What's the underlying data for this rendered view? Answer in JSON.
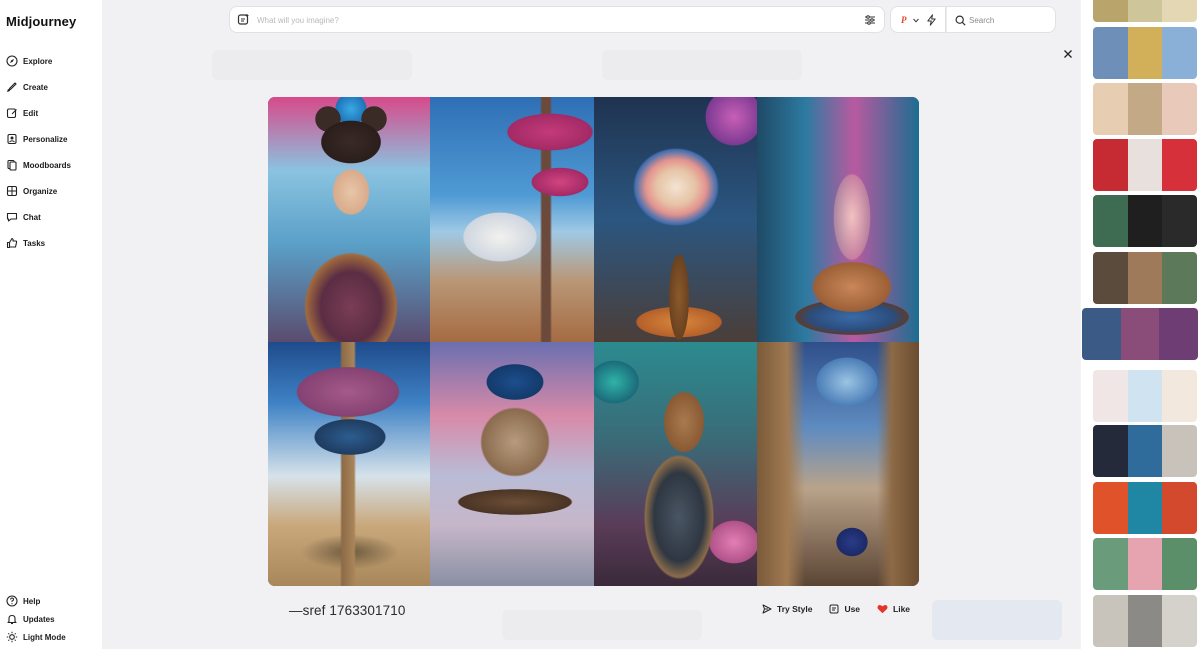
{
  "app": {
    "title": "Midjourney"
  },
  "sidebar": {
    "items": [
      {
        "label": "Explore",
        "icon": "compass-icon"
      },
      {
        "label": "Create",
        "icon": "brush-icon"
      },
      {
        "label": "Edit",
        "icon": "edit-icon"
      },
      {
        "label": "Personalize",
        "icon": "personalize-icon"
      },
      {
        "label": "Moodboards",
        "icon": "moodboard-icon"
      },
      {
        "label": "Organize",
        "icon": "grid-icon"
      },
      {
        "label": "Chat",
        "icon": "chat-icon"
      },
      {
        "label": "Tasks",
        "icon": "thumbs-up-icon"
      }
    ],
    "bottom": [
      {
        "label": "Help",
        "icon": "help-icon"
      },
      {
        "label": "Updates",
        "icon": "bell-icon"
      },
      {
        "label": "Light Mode",
        "icon": "sun-icon"
      }
    ]
  },
  "prompt": {
    "placeholder": "What will you imagine?"
  },
  "mode": {
    "badge": "P"
  },
  "search": {
    "placeholder": "Search"
  },
  "detail": {
    "sref_prefix": "—sref",
    "sref_code": "1763301710",
    "actions": {
      "try_style": "Try Style",
      "use": "Use",
      "like": "Like"
    }
  },
  "colors": {
    "like": "#e5342a",
    "accent": "#e0452e"
  },
  "thumbnails": [
    [
      "#b9a56b",
      "#cfc59a",
      "#e3d7b4"
    ],
    [
      "#6e8fb7",
      "#d2b05a",
      "#8ab0d8"
    ],
    [
      "#e7cdb2",
      "#c4a987",
      "#e9c9b9"
    ],
    [
      "#c62b33",
      "#e8e0dc",
      "#d6303b"
    ],
    [
      "#3d6c52",
      "#1f1f1f",
      "#2a2a2a"
    ],
    [
      "#5a4b3c",
      "#9f7a5a",
      "#5c7a59"
    ],
    [
      "#3b5b86",
      "#8a4d79",
      "#6e3d74"
    ],
    [
      "#f1e6e6",
      "#cfe3f0",
      "#f2e8dd"
    ],
    [
      "#242a3a",
      "#2f6c9c",
      "#c9c2ba"
    ],
    [
      "#e0532a",
      "#1f86a4",
      "#d2492e"
    ],
    [
      "#6a9c7c",
      "#e6a3b0",
      "#5a8f6a"
    ],
    [
      "#c8c4bc",
      "#8c8a86",
      "#d5d2cc"
    ]
  ]
}
